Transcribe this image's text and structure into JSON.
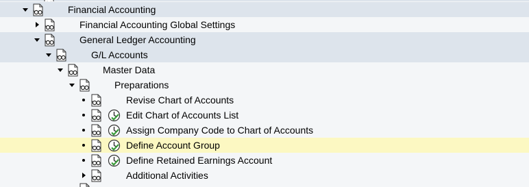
{
  "tree": {
    "financial_accounting": "Financial Accounting",
    "fa_global_settings": "Financial Accounting Global Settings",
    "general_ledger_accounting": "General Ledger Accounting",
    "gl_accounts": "G/L Accounts",
    "master_data": "Master Data",
    "preparations": "Preparations",
    "revise_chart": "Revise Chart of Accounts",
    "edit_chart_list": "Edit Chart of Accounts List",
    "assign_company_code": "Assign Company Code to Chart of Accounts",
    "define_account_group": "Define Account Group",
    "define_retained_earnings": "Define Retained Earnings Account",
    "additional_activities": "Additional Activities"
  },
  "colors": {
    "band": "#dde4ec",
    "background": "#f4f6f8",
    "selected_row": "#fcf8c2",
    "clock_green": "#3a9a3a"
  },
  "icons": [
    "document-glasses-icon",
    "clock-execute-icon",
    "expand-triangle-icon",
    "collapse-triangle-icon",
    "leaf-bullet-icon"
  ]
}
